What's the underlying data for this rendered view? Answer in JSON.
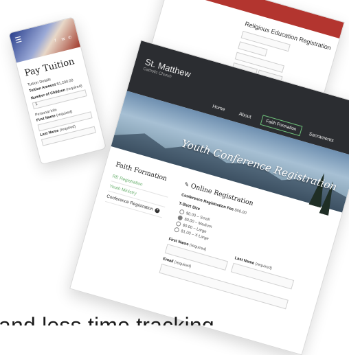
{
  "religious_education": {
    "title": "Religious Education Registration"
  },
  "phone": {
    "title": "Pay Tuition",
    "tuition_details": "Tuition Details",
    "tuition_amount_label": "Tuition Amount",
    "tuition_amount": "$1,200.00",
    "children_label": "Number of Children",
    "required_note": "(required)",
    "children_value": "1",
    "personal_info": "Personal Info",
    "first_name_label": "First Name",
    "last_name_label": "Last Name"
  },
  "main": {
    "brand": "St. Matthew",
    "brand_sub": "Catholic Church",
    "nav": [
      "Home",
      "About",
      "Faith Formation",
      "Sacraments"
    ],
    "hero_title": "Youth Conference Registration",
    "sidebar": {
      "heading": "Faith Formation",
      "items": [
        "RE Registration",
        "Youth Ministry",
        "Conference Registration"
      ]
    },
    "form": {
      "title": "Online Registration",
      "fee_label": "Conference Registration Fee",
      "fee_value": "$50.00",
      "shirt_label": "T-Shirt Size",
      "shirt_options": [
        "$0.00 – Small",
        "$0.00 – Medium",
        "$0.00 – Large",
        "$1.00 – X-Large"
      ],
      "first_name_label": "First Name",
      "last_name_label": "Last Name",
      "email_label": "Email",
      "required_note": "(required)"
    }
  },
  "headline": "and less time tracking"
}
